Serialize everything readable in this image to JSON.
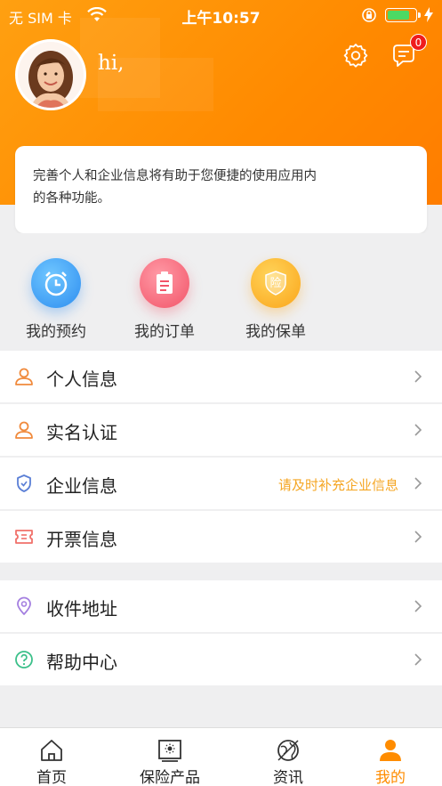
{
  "status_bar": {
    "carrier": "无 SIM 卡",
    "time": "上午10:57"
  },
  "profile": {
    "greeting": "hi,",
    "message_count": "0"
  },
  "notice": {
    "text": "完善个人和企业信息将有助于您便捷的使用应用内的各种功能。"
  },
  "shortcuts": [
    {
      "label": "我的预约",
      "icon": "alarm-clock-icon"
    },
    {
      "label": "我的订单",
      "icon": "clipboard-icon"
    },
    {
      "label": "我的保单",
      "icon": "shield-insurance-icon"
    }
  ],
  "shortcut_badge_char": "险",
  "menu": {
    "personal_info": "个人信息",
    "real_name": "实名认证",
    "company_info": "企业信息",
    "company_hint": "请及时补充企业信息",
    "invoice_info": "开票信息",
    "address": "收件地址",
    "help": "帮助中心"
  },
  "tabs": [
    {
      "label": "首页",
      "icon": "home-icon"
    },
    {
      "label": "保险产品",
      "icon": "insurance-product-icon"
    },
    {
      "label": "资讯",
      "icon": "news-icon"
    },
    {
      "label": "我的",
      "icon": "profile-icon"
    }
  ],
  "colors": {
    "accent": "#ff8c00",
    "hint": "#f5a623",
    "badge": "#f01c1c"
  }
}
